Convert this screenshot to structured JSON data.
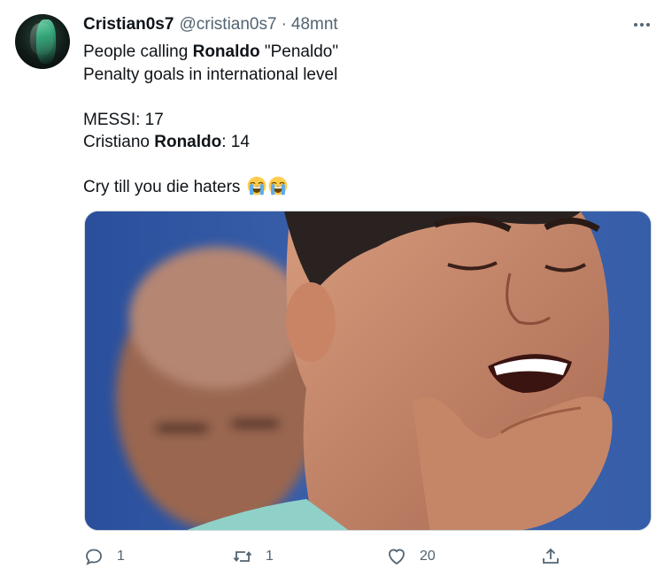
{
  "tweet": {
    "author_name": "Cristian0s7",
    "author_handle": "@cristian0s7",
    "separator": "·",
    "timestamp": "48mnt",
    "lines": {
      "l1_pre": "People calling ",
      "l1_bold": "Ronaldo",
      "l1_post": " \"Penaldo\"",
      "l2": "Penalty goals in international level",
      "l3": "MESSI: 17",
      "l4_pre": "Cristiano ",
      "l4_bold": "Ronaldo",
      "l4_post": ": 14",
      "l5": "Cry till you die haters"
    },
    "emojis": [
      "loudly-crying-face-emoji",
      "loudly-crying-face-emoji"
    ],
    "reply_count": "1",
    "retweet_count": "1",
    "like_count": "20"
  },
  "colors": {
    "text": "#0f1419",
    "secondary": "#536471",
    "photo_blue": "#2b4f9a"
  }
}
